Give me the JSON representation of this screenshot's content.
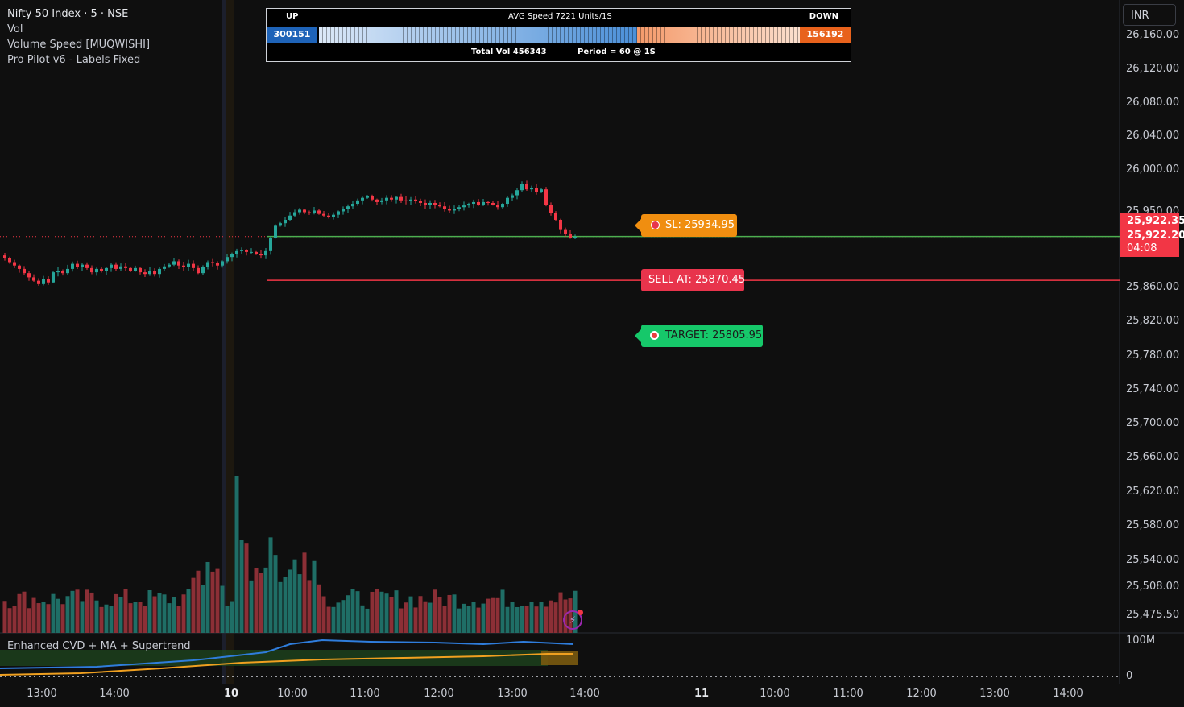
{
  "symbol_legend": {
    "title": "Nifty 50 Index · 5 · NSE",
    "indicators": [
      "Vol",
      "Volume Speed [MUQWISHI]",
      "Pro Pilot v6 - Labels Fixed"
    ]
  },
  "volume_speed_panel": {
    "up_label": "UP",
    "avg_speed": "AVG Speed 7221 Units/1S",
    "down_label": "DOWN",
    "up_value": "300151",
    "down_value": "156192",
    "total_vol": "Total Vol 456343",
    "period": "Period = 60 @ 1S",
    "up_fraction": 0.658
  },
  "currency_button": "INR",
  "price_axis": [
    "26,160.00",
    "26,120.00",
    "26,080.00",
    "26,040.00",
    "26,000.00",
    "25,950.00",
    "25,860.00",
    "25,820.00",
    "25,780.00",
    "25,740.00",
    "25,700.00",
    "25,660.00",
    "25,620.00",
    "25,580.00",
    "25,540.00",
    "25,508.00",
    "25,475.50"
  ],
  "price_badges": {
    "high": "25,922.35",
    "last": "25,922.20",
    "countdown": "04:08"
  },
  "cvd_axis": {
    "top": "100M",
    "zero": "0"
  },
  "time_axis": [
    {
      "label": "13:00",
      "bold": false
    },
    {
      "label": "14:00",
      "bold": false
    },
    {
      "label": "10",
      "bold": true
    },
    {
      "label": "10:00",
      "bold": false
    },
    {
      "label": "11:00",
      "bold": false
    },
    {
      "label": "12:00",
      "bold": false
    },
    {
      "label": "13:00",
      "bold": false
    },
    {
      "label": "14:00",
      "bold": false
    },
    {
      "label": "11",
      "bold": true
    },
    {
      "label": "10:00",
      "bold": false
    },
    {
      "label": "11:00",
      "bold": false
    },
    {
      "label": "12:00",
      "bold": false
    },
    {
      "label": "13:00",
      "bold": false
    },
    {
      "label": "14:00",
      "bold": false
    }
  ],
  "trade_labels": {
    "sl": "SL: 25934.95",
    "sell": "SELL AT: 25870.45",
    "target": "TARGET: 25805.95"
  },
  "cvd_indicator_title": "Enhanced CVD + MA + Supertrend",
  "colors": {
    "up": "#26a69a",
    "down": "#f23645",
    "sl_line": "#4caf50",
    "sell_line": "#f23645",
    "badge": "#f23645"
  },
  "chart_data": {
    "type": "candlestick",
    "y_range": [
      25475.5,
      26160
    ],
    "levels": {
      "sl_line": 25922.35,
      "sell_line": 25870.45,
      "last_price": 25922.2
    },
    "closes": [
      25897,
      25892,
      25888,
      25884,
      25879,
      25874,
      25870,
      25866,
      25872,
      25868,
      25880,
      25882,
      25879,
      25884,
      25890,
      25886,
      25889,
      25885,
      25880,
      25884,
      25882,
      25885,
      25889,
      25884,
      25887,
      25885,
      25882,
      25885,
      25880,
      25878,
      25882,
      25878,
      25884,
      25887,
      25889,
      25893,
      25888,
      25886,
      25890,
      25885,
      25879,
      25886,
      25892,
      25891,
      25888,
      25893,
      25898,
      25902,
      25905,
      25906,
      25904,
      25904,
      25902,
      25900,
      25905,
      25921,
      25935,
      25938,
      25942,
      25947,
      25951,
      25954,
      25951,
      25950,
      25953,
      25949,
      25947,
      25945,
      25948,
      25952,
      25955,
      25958,
      25961,
      25965,
      25968,
      25970,
      25966,
      25963,
      25965,
      25968,
      25966,
      25969,
      25965,
      25964,
      25966,
      25964,
      25962,
      25960,
      25962,
      25960,
      25958,
      25955,
      25953,
      25955,
      25957,
      25959,
      25961,
      25963,
      25960,
      25963,
      25962,
      25960,
      25957,
      25961,
      25968,
      25971,
      25977,
      25984,
      25978,
      25980,
      25975,
      25978,
      25960,
      25950,
      25942,
      25930,
      25925,
      25921,
      25922
    ]
  }
}
